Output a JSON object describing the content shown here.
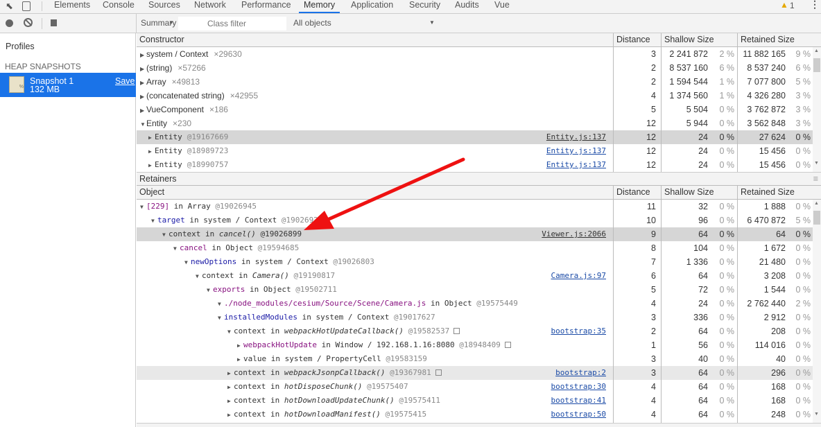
{
  "tabs": {
    "items": [
      "Elements",
      "Console",
      "Sources",
      "Network",
      "Performance",
      "Memory",
      "Application",
      "Security",
      "Audits",
      "Vue"
    ],
    "active": "Memory",
    "warning_count": "1"
  },
  "toolbar": {
    "view": "Summary",
    "class_filter_placeholder": "Class filter",
    "objects_filter": "All objects"
  },
  "sidebar": {
    "profiles": "Profiles",
    "section": "HEAP SNAPSHOTS",
    "snapshot_name": "Snapshot 1",
    "snapshot_size": "132 MB",
    "save": "Save"
  },
  "top": {
    "headers": [
      "Constructor",
      "Distance",
      "Shallow Size",
      "Retained Size"
    ],
    "rows": [
      {
        "depth": 0,
        "arrow": "collapsed",
        "name": "system / Context",
        "count": "×29630",
        "distance": "3",
        "shallow": "2 241 872",
        "shallow_pct": "2 %",
        "retained": "11 882 165",
        "retained_pct": "9 %"
      },
      {
        "depth": 0,
        "arrow": "collapsed",
        "name": "(string)",
        "count": "×57266",
        "distance": "2",
        "shallow": "8 537 160",
        "shallow_pct": "6 %",
        "retained": "8 537 240",
        "retained_pct": "6 %"
      },
      {
        "depth": 0,
        "arrow": "collapsed",
        "name": "Array",
        "count": "×49813",
        "distance": "2",
        "shallow": "1 594 544",
        "shallow_pct": "1 %",
        "retained": "7 077 800",
        "retained_pct": "5 %"
      },
      {
        "depth": 0,
        "arrow": "collapsed",
        "name": "(concatenated string)",
        "count": "×42955",
        "distance": "4",
        "shallow": "1 374 560",
        "shallow_pct": "1 %",
        "retained": "4 326 280",
        "retained_pct": "3 %"
      },
      {
        "depth": 0,
        "arrow": "collapsed",
        "name": "VueComponent",
        "count": "×186",
        "distance": "5",
        "shallow": "5 504",
        "shallow_pct": "0 %",
        "retained": "3 762 872",
        "retained_pct": "3 %"
      },
      {
        "depth": 0,
        "arrow": "expanded",
        "name": "Entity",
        "count": "×230",
        "distance": "12",
        "shallow": "5 944",
        "shallow_pct": "0 %",
        "retained": "3 562 848",
        "retained_pct": "3 %"
      },
      {
        "depth": 1,
        "arrow": "collapsed",
        "mono": true,
        "name": "Entity",
        "id": "@19167669",
        "link": "Entity.js:137",
        "state": "sel",
        "distance": "12",
        "shallow": "24",
        "shallow_pct": "0 %",
        "retained": "27 624",
        "retained_pct": "0 %"
      },
      {
        "depth": 1,
        "arrow": "collapsed",
        "mono": true,
        "name": "Entity",
        "id": "@18989723",
        "link": "Entity.js:137",
        "distance": "12",
        "shallow": "24",
        "shallow_pct": "0 %",
        "retained": "15 456",
        "retained_pct": "0 %"
      },
      {
        "depth": 1,
        "arrow": "collapsed",
        "mono": true,
        "name": "Entity",
        "id": "@18990757",
        "link": "Entity.js:137",
        "distance": "12",
        "shallow": "24",
        "shallow_pct": "0 %",
        "retained": "15 456",
        "retained_pct": "0 %"
      }
    ]
  },
  "retainers": {
    "title": "Retainers",
    "headers": [
      "Object",
      "Distance",
      "Shallow Size",
      "Retained Size"
    ],
    "rows": [
      {
        "depth": 0,
        "arrow": "expanded",
        "prop": "[229]",
        "prop_color": "#881280",
        "mid": " in Array ",
        "id": "@19026945",
        "distance": "11",
        "shallow": "32",
        "shallow_pct": "0 %",
        "retained": "1 888",
        "retained_pct": "0 %"
      },
      {
        "depth": 1,
        "arrow": "expanded",
        "prop": "target",
        "prop_color": "#1a1aa6",
        "mid": " in system / Context ",
        "id": "@19026921",
        "distance": "10",
        "shallow": "96",
        "shallow_pct": "0 %",
        "retained": "6 470 872",
        "retained_pct": "5 %"
      },
      {
        "depth": 2,
        "arrow": "expanded",
        "prop": "context",
        "prop_color": "#333333",
        "mid": " in ",
        "fn": "cancel()",
        "id": " @19026899",
        "link": "Viewer.js:2066",
        "state": "sel",
        "distance": "9",
        "shallow": "64",
        "shallow_pct": "0 %",
        "retained": "64",
        "retained_pct": "0 %"
      },
      {
        "depth": 3,
        "arrow": "expanded",
        "prop": "cancel",
        "prop_color": "#881280",
        "mid": " in Object ",
        "id": "@19594685",
        "distance": "8",
        "shallow": "104",
        "shallow_pct": "0 %",
        "retained": "1 672",
        "retained_pct": "0 %"
      },
      {
        "depth": 4,
        "arrow": "expanded",
        "prop": "newOptions",
        "prop_color": "#1a1aa6",
        "mid": " in system / Context ",
        "id": "@19026803",
        "distance": "7",
        "shallow": "1 336",
        "shallow_pct": "0 %",
        "retained": "21 480",
        "retained_pct": "0 %"
      },
      {
        "depth": 5,
        "arrow": "expanded",
        "prop": "context",
        "prop_color": "#333333",
        "mid": " in ",
        "fn": "Camera()",
        "id": " @19190817",
        "link": "Camera.js:97",
        "distance": "6",
        "shallow": "64",
        "shallow_pct": "0 %",
        "retained": "3 208",
        "retained_pct": "0 %"
      },
      {
        "depth": 6,
        "arrow": "expanded",
        "prop": "exports",
        "prop_color": "#881280",
        "mid": " in Object ",
        "id": "@19502711",
        "distance": "5",
        "shallow": "72",
        "shallow_pct": "0 %",
        "retained": "1 544",
        "retained_pct": "0 %"
      },
      {
        "depth": 7,
        "arrow": "expanded",
        "prop": "./node_modules/cesium/Source/Scene/Camera.js",
        "prop_color": "#881280",
        "mid": " in Object ",
        "id": "@19575449",
        "distance": "4",
        "shallow": "24",
        "shallow_pct": "0 %",
        "retained": "2 762 440",
        "retained_pct": "2 %"
      },
      {
        "depth": 8,
        "arrow": "expanded",
        "prop": "installedModules",
        "prop_color": "#1a1aa6",
        "mid": " in system / Context ",
        "id": "@19017627",
        "distance": "3",
        "shallow": "336",
        "shallow_pct": "0 %",
        "retained": "2 912",
        "retained_pct": "0 %"
      },
      {
        "depth": 9,
        "arrow": "expanded",
        "prop": "context",
        "prop_color": "#333333",
        "mid": " in ",
        "fn": "webpackHotUpdateCallback()",
        "id": " @19582537",
        "box": true,
        "link": "bootstrap:35",
        "distance": "2",
        "shallow": "64",
        "shallow_pct": "0 %",
        "retained": "208",
        "retained_pct": "0 %"
      },
      {
        "depth": 10,
        "arrow": "collapsed",
        "prop": "webpackHotUpdate",
        "prop_color": "#881280",
        "mid": " in Window / 192.168.1.16:8080 ",
        "id": "@18948409",
        "box": true,
        "distance": "1",
        "shallow": "56",
        "shallow_pct": "0 %",
        "retained": "114 016",
        "retained_pct": "0 %"
      },
      {
        "depth": 10,
        "arrow": "collapsed",
        "prop": "value",
        "prop_color": "#333333",
        "mid": " in system / PropertyCell ",
        "id": "@19583159",
        "distance": "3",
        "shallow": "40",
        "shallow_pct": "0 %",
        "retained": "40",
        "retained_pct": "0 %"
      },
      {
        "depth": 9,
        "arrow": "collapsed",
        "prop": "context",
        "prop_color": "#333333",
        "mid": " in ",
        "fn": "webpackJsonpCallback()",
        "id": " @19367981",
        "box": true,
        "link": "bootstrap:2",
        "state": "hov",
        "distance": "3",
        "shallow": "64",
        "shallow_pct": "0 %",
        "retained": "296",
        "retained_pct": "0 %"
      },
      {
        "depth": 9,
        "arrow": "collapsed",
        "prop": "context",
        "prop_color": "#333333",
        "mid": " in ",
        "fn": "hotDisposeChunk()",
        "id": " @19575407",
        "link": "bootstrap:30",
        "distance": "4",
        "shallow": "64",
        "shallow_pct": "0 %",
        "retained": "168",
        "retained_pct": "0 %"
      },
      {
        "depth": 9,
        "arrow": "collapsed",
        "prop": "context",
        "prop_color": "#333333",
        "mid": " in ",
        "fn": "hotDownloadUpdateChunk()",
        "id": " @19575411",
        "link": "bootstrap:41",
        "distance": "4",
        "shallow": "64",
        "shallow_pct": "0 %",
        "retained": "168",
        "retained_pct": "0 %"
      },
      {
        "depth": 9,
        "arrow": "collapsed",
        "prop": "context",
        "prop_color": "#333333",
        "mid": " in ",
        "fn": "hotDownloadManifest()",
        "id": " @19575415",
        "link": "bootstrap:50",
        "distance": "4",
        "shallow": "64",
        "shallow_pct": "0 %",
        "retained": "248",
        "retained_pct": "0 %"
      }
    ]
  },
  "annotation": {
    "arrow_color": "#ee1111"
  }
}
